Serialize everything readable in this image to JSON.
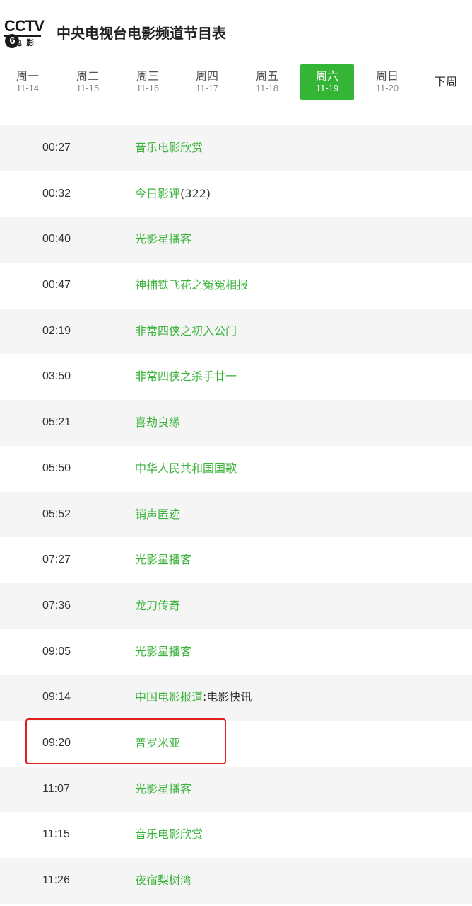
{
  "header": {
    "logo_main": "CCTV",
    "logo_number": "6",
    "logo_sub": "电影",
    "title": "中央电视台电影频道节目表"
  },
  "tabs": [
    {
      "day": "周一",
      "date": "11-14",
      "active": false
    },
    {
      "day": "周二",
      "date": "11-15",
      "active": false
    },
    {
      "day": "周三",
      "date": "11-16",
      "active": false
    },
    {
      "day": "周四",
      "date": "11-17",
      "active": false
    },
    {
      "day": "周五",
      "date": "11-18",
      "active": false
    },
    {
      "day": "周六",
      "date": "11-19",
      "active": true
    },
    {
      "day": "周日",
      "date": "11-20",
      "active": false
    }
  ],
  "next_week": "下周",
  "schedule": [
    {
      "time": "00:27",
      "title": "音乐电影欣赏",
      "suffix": ""
    },
    {
      "time": "00:32",
      "title": "今日影评",
      "suffix": "(322)"
    },
    {
      "time": "00:40",
      "title": "光影星播客",
      "suffix": ""
    },
    {
      "time": "00:47",
      "title": "神捕铁飞花之冤冤相报",
      "suffix": ""
    },
    {
      "time": "02:19",
      "title": "非常四侠之初入公门",
      "suffix": ""
    },
    {
      "time": "03:50",
      "title": "非常四侠之杀手廿一",
      "suffix": ""
    },
    {
      "time": "05:21",
      "title": "喜劫良缘",
      "suffix": ""
    },
    {
      "time": "05:50",
      "title": "中华人民共和国国歌",
      "suffix": ""
    },
    {
      "time": "05:52",
      "title": "销声匿迹",
      "suffix": ""
    },
    {
      "time": "07:27",
      "title": "光影星播客",
      "suffix": ""
    },
    {
      "time": "07:36",
      "title": "龙刀传奇",
      "suffix": ""
    },
    {
      "time": "09:05",
      "title": "光影星播客",
      "suffix": ""
    },
    {
      "time": "09:14",
      "title": "中国电影报道",
      "suffix": ":电影快讯"
    },
    {
      "time": "09:20",
      "title": "普罗米亚",
      "suffix": ""
    },
    {
      "time": "11:07",
      "title": "光影星播客",
      "suffix": ""
    },
    {
      "time": "11:15",
      "title": "音乐电影欣赏",
      "suffix": ""
    },
    {
      "time": "11:26",
      "title": "夜宿梨树湾",
      "suffix": ""
    }
  ],
  "colors": {
    "accent_green": "#35b535",
    "link_green": "#3bb33b",
    "highlight_red": "#e02020",
    "row_shade": "#f5f5f5"
  }
}
